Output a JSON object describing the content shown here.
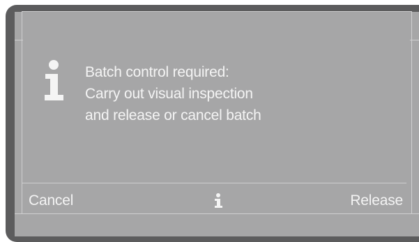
{
  "dialog": {
    "icon": "info-icon",
    "message_lines": [
      "Batch control required:",
      "Carry out visual inspection",
      "and release or cancel batch"
    ]
  },
  "softkeys": {
    "left_label": "Cancel",
    "center_icon": "info-icon",
    "right_label": "Release"
  },
  "colors": {
    "frame": "#5c5c5d",
    "screen": "#a6a6a7",
    "text": "#f4f4f4",
    "divider": "#cfcfd0"
  }
}
